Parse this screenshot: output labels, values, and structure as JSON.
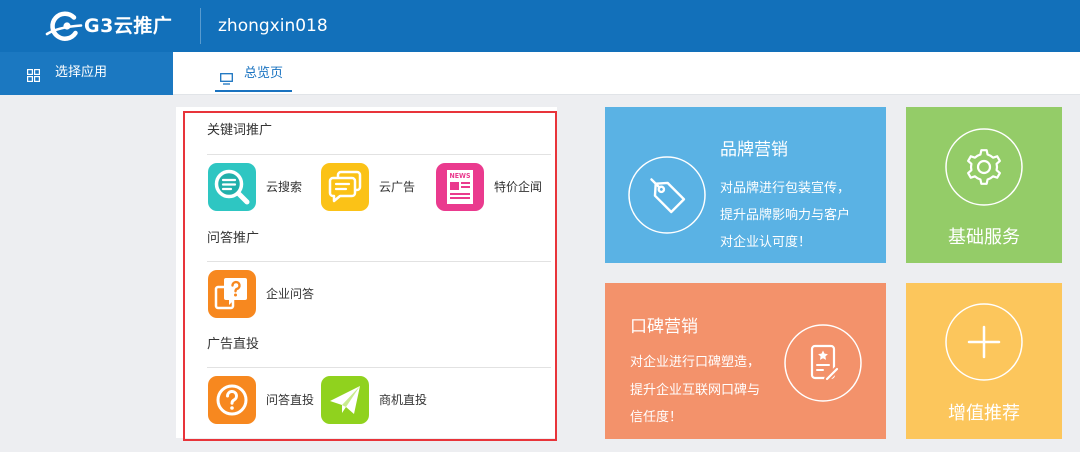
{
  "header": {
    "logo_text": "G3云推广",
    "logo_icon": "swirl-logo-icon",
    "username": "zhongxin018"
  },
  "app_selector": {
    "label": "选择应用",
    "icon": "grid-icon"
  },
  "tabs": [
    {
      "label": "总览页",
      "icon": "monitor-icon",
      "active": true
    }
  ],
  "promotion_panel": {
    "sections": [
      {
        "title": "关键词推广",
        "items": [
          {
            "label": "云搜索",
            "icon": "search-icon",
            "color": "#2ec6c2"
          },
          {
            "label": "云广告",
            "icon": "chat-icon",
            "color": "#fbc217"
          },
          {
            "label": "特价企闻",
            "icon": "news-icon",
            "icon_text": "NEWS",
            "color": "#ea3a8e"
          }
        ]
      },
      {
        "title": "问答推广",
        "items": [
          {
            "label": "企业问答",
            "icon": "qa-icon",
            "color": "#f7881f"
          }
        ]
      },
      {
        "title": "广告直投",
        "items": [
          {
            "label": "问答直投",
            "icon": "question-circle-icon",
            "color": "#f7881f"
          },
          {
            "label": "商机直投",
            "icon": "paper-plane-icon",
            "color": "#90d21e"
          }
        ]
      }
    ]
  },
  "tiles": {
    "brand_marketing": {
      "title": "品牌营销",
      "description": [
        "对品牌进行包装宣传，",
        "提升品牌影响力与客户",
        "对企业认可度！"
      ],
      "icon": "tag-icon",
      "color": "#5ab2e4"
    },
    "basic_services": {
      "title": "基础服务",
      "icon": "gear-icon",
      "color": "#94cc68"
    },
    "word_of_mouth_marketing": {
      "title": "口碑营销",
      "description": [
        "对企业进行口碑塑造，",
        "提升企业互联网口碑与",
        "信任度！"
      ],
      "icon": "certificate-icon",
      "color": "#f3926b"
    },
    "value_added_recommendations": {
      "title": "增值推荐",
      "icon": "plus-icon",
      "color": "#fcc65c"
    }
  },
  "theme": {
    "header_bg": "#1270ba",
    "app_selector_bg": "#1b78c1",
    "accent": "#1a73c0",
    "page_bg": "#edeef1",
    "highlight_border": "#e8343a"
  }
}
